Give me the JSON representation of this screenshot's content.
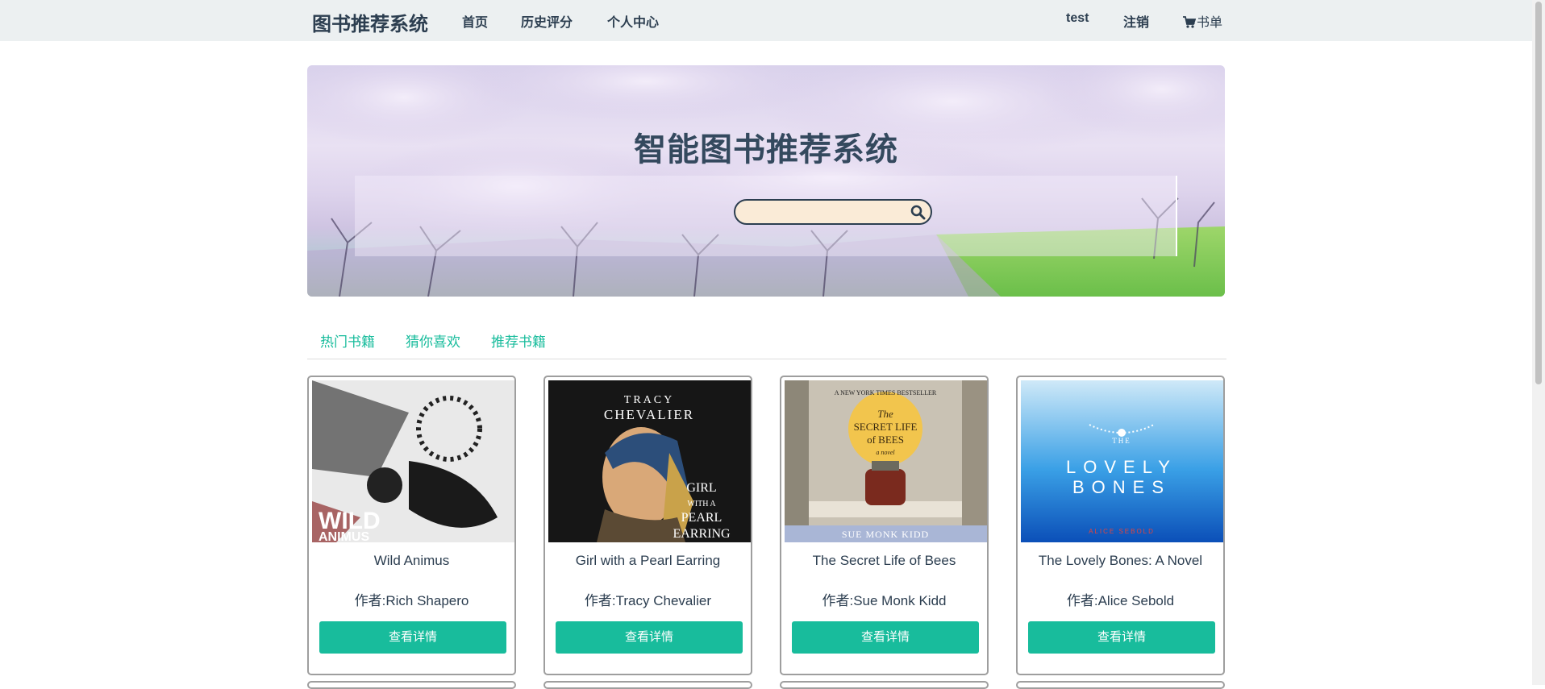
{
  "navbar": {
    "brand": "图书推荐系统",
    "links": [
      "首页",
      "历史评分",
      "个人中心"
    ],
    "user": "test",
    "logout": "注销",
    "booklist": "书单"
  },
  "hero": {
    "title": "智能图书推荐系统",
    "search_value": ""
  },
  "tabs": [
    "热门书籍",
    "猜你喜欢",
    "推荐书籍"
  ],
  "books": [
    {
      "title": "Wild Animus",
      "author": "作者:Rich Shapero",
      "cover_text": [
        "WILD",
        "ANIMUS"
      ],
      "button": "查看详情"
    },
    {
      "title": "Girl with a Pearl Earring",
      "author": "作者:Tracy Chevalier",
      "cover_text": [
        "TRACY",
        "CHEVALIER",
        "GIRL",
        "WITH A",
        "PEARL",
        "EARRING"
      ],
      "button": "查看详情"
    },
    {
      "title": "The Secret Life of Bees",
      "author": "作者:Sue Monk Kidd",
      "cover_text": [
        "A NEW YORK TIMES BESTSELLER",
        "The",
        "SECRET LIFE",
        "of BEES",
        "a novel",
        "SUE MONK KIDD"
      ],
      "button": "查看详情"
    },
    {
      "title": "The Lovely Bones: A Novel",
      "author": "作者:Alice Sebold",
      "cover_text": [
        "THE",
        "LOVELY",
        "BONES",
        "ALICE SEBOLD"
      ],
      "button": "查看详情"
    }
  ],
  "colors": {
    "navbar_bg": "#ecf0f1",
    "primary_text": "#2c3e50",
    "accent": "#18bc9c",
    "search_bg": "#faebd7"
  }
}
